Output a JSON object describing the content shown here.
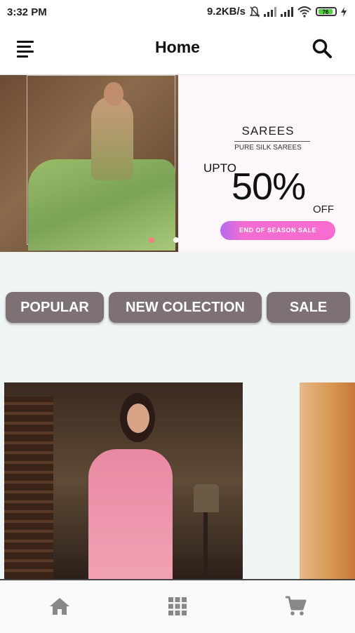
{
  "status_bar": {
    "time": "3:32 PM",
    "speed": "9.2KB/s",
    "battery": "76"
  },
  "app_bar": {
    "title": "Home",
    "menu_icon": "menu-icon",
    "search_icon": "search-icon"
  },
  "banner": {
    "category": "SAREES",
    "subtitle": "PURE SILK SAREES",
    "upto": "UPTO",
    "discount": "50%",
    "off": "OFF",
    "sale_label": "END OF SEASON SALE",
    "sale_colors": [
      "#b66bf0",
      "#f96cd0"
    ],
    "dots_active_color": "#f08080"
  },
  "categories": [
    {
      "label": "POPULAR"
    },
    {
      "label": "NEW COLECTION"
    },
    {
      "label": "SALE"
    }
  ],
  "bottom_nav": [
    {
      "icon": "home-icon"
    },
    {
      "icon": "grid-icon"
    },
    {
      "icon": "cart-icon"
    }
  ],
  "colors": {
    "chip_bg": "#7d7174",
    "content_bg": "#eff4f5"
  }
}
